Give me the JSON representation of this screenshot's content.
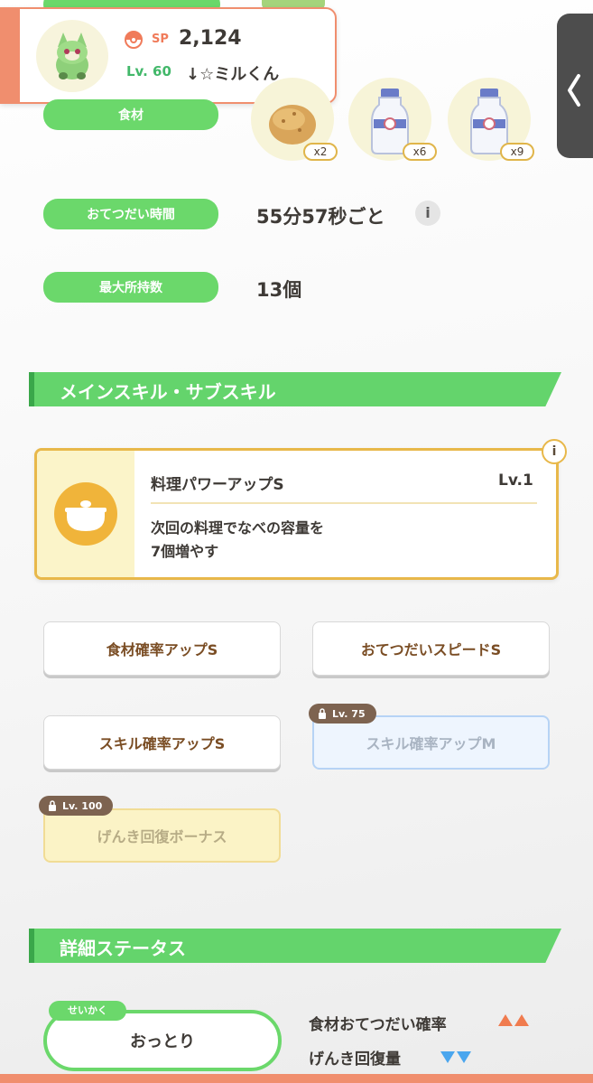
{
  "popup": {
    "sp_label": "SP",
    "sp_value": "2,124",
    "level": "Lv. 60",
    "nickname": "↓☆ミルくん",
    "accent": "#f08e6e"
  },
  "ingredients": {
    "label": "食材",
    "items": [
      {
        "name": "potato-icon",
        "count": "x2"
      },
      {
        "name": "milk-bottle-icon",
        "count": "x6"
      },
      {
        "name": "milk-bottle-icon",
        "count": "x9"
      }
    ]
  },
  "help_time": {
    "label": "おてつだい時間",
    "value": "55分57秒ごと"
  },
  "max_carry": {
    "label": "最大所持数",
    "value": "13個"
  },
  "skills_section": {
    "title": "メインスキル・サブスキル"
  },
  "main_skill": {
    "name": "料理パワーアップS",
    "level": "Lv.1",
    "desc_line1": "次回の料理でなべの容量を",
    "desc_line2": "7個増やす",
    "info": "i"
  },
  "sub_skills": [
    {
      "label": "食材確率アップS",
      "locked": false,
      "lock_level": ""
    },
    {
      "label": "おてつだいスピードS",
      "locked": false,
      "lock_level": ""
    },
    {
      "label": "スキル確率アップS",
      "locked": false,
      "lock_level": ""
    },
    {
      "label": "スキル確率アップM",
      "locked": true,
      "lock_level": "Lv. 75"
    },
    {
      "label": "げんき回復ボーナス",
      "locked": true,
      "lock_level": "Lv. 100"
    }
  ],
  "detail_section": {
    "title": "詳細ステータス"
  },
  "nature": {
    "tag": "せいかく",
    "value": "おっとり",
    "up": "食材おてつだい確率",
    "down": "げんき回復量"
  },
  "colors": {
    "green": "#6bd86b",
    "gold": "#e8b84a",
    "up": "#f07b4e",
    "down": "#4aa6ee"
  },
  "info_glyph": "i"
}
